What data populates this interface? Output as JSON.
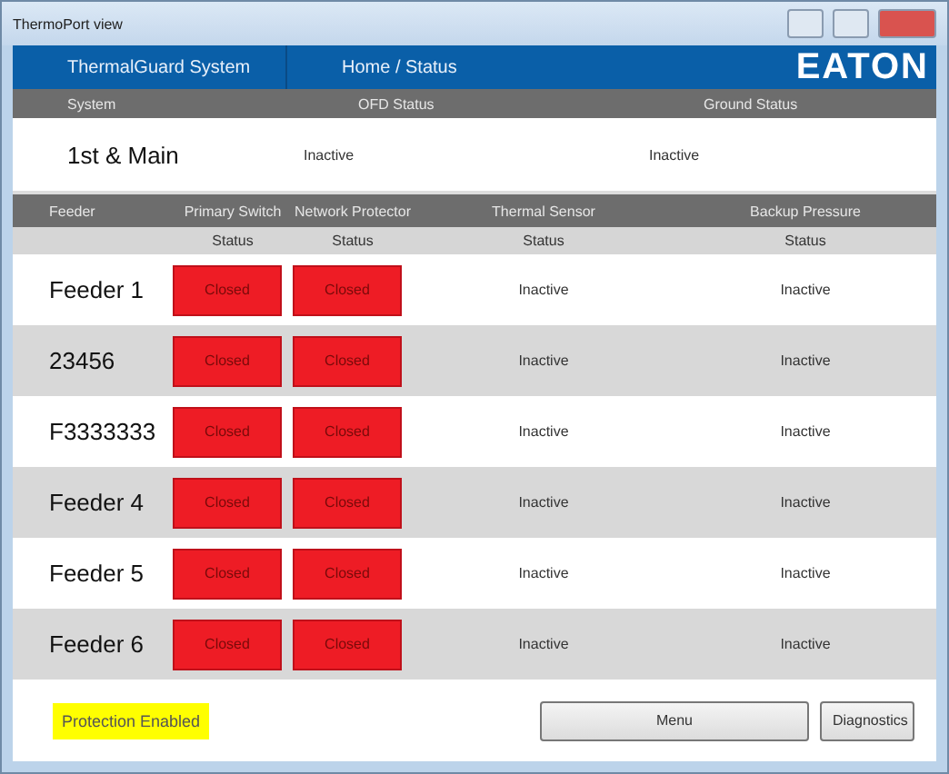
{
  "window": {
    "title": "ThermoPort view"
  },
  "header": {
    "system_name": "ThermalGuard System",
    "breadcrumb": "Home / Status",
    "logo": "EATON"
  },
  "system": {
    "columns": [
      "System",
      "OFD Status",
      "Ground Status"
    ],
    "row": {
      "name": "1st & Main",
      "ofd_status": "Inactive",
      "ground_status": "Inactive"
    }
  },
  "feeders": {
    "columns": [
      "Feeder",
      "Primary Switch",
      "Network Protector",
      "Thermal Sensor",
      "Backup Pressure"
    ],
    "subcolumns": [
      "Status",
      "Status",
      "Status",
      "Status"
    ],
    "rows": [
      {
        "name": "Feeder 1",
        "primary": "Closed",
        "network": "Closed",
        "thermal": "Inactive",
        "pressure": "Inactive"
      },
      {
        "name": "23456",
        "primary": "Closed",
        "network": "Closed",
        "thermal": "Inactive",
        "pressure": "Inactive"
      },
      {
        "name": "F3333333",
        "primary": "Closed",
        "network": "Closed",
        "thermal": "Inactive",
        "pressure": "Inactive"
      },
      {
        "name": "Feeder 4",
        "primary": "Closed",
        "network": "Closed",
        "thermal": "Inactive",
        "pressure": "Inactive"
      },
      {
        "name": "Feeder 5",
        "primary": "Closed",
        "network": "Closed",
        "thermal": "Inactive",
        "pressure": "Inactive"
      },
      {
        "name": "Feeder 6",
        "primary": "Closed",
        "network": "Closed",
        "thermal": "Inactive",
        "pressure": "Inactive"
      }
    ]
  },
  "footer": {
    "status": "Protection Enabled",
    "buttons": [
      "Menu",
      "Diagnostics"
    ]
  }
}
